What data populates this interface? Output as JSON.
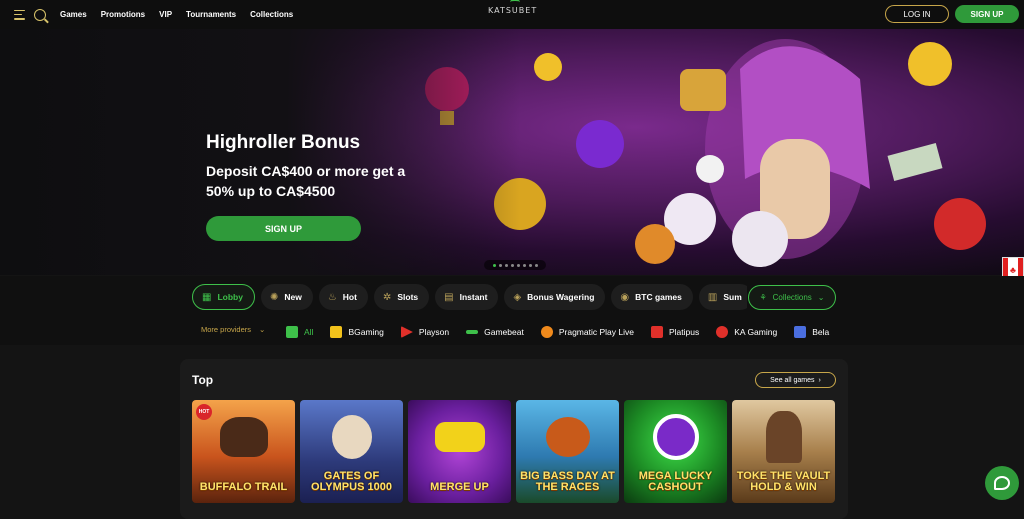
{
  "header": {
    "nav": [
      "Games",
      "Promotions",
      "VIP",
      "Tournaments",
      "Collections"
    ],
    "logo_text": "KATSUBET",
    "login_label": "LOG IN",
    "signup_label": "SIGN UP"
  },
  "hero": {
    "title": "Highroller Bonus",
    "subtitle": "Deposit CA$400 or more get a 50% up to CA$4500",
    "cta_label": "SIGN UP",
    "slides_total": 8,
    "active_slide": 1
  },
  "categories": [
    {
      "label": "Lobby",
      "icon": "lobby-icon",
      "active": true
    },
    {
      "label": "New",
      "icon": "new-icon"
    },
    {
      "label": "Hot",
      "icon": "flame-icon"
    },
    {
      "label": "Slots",
      "icon": "slots-icon"
    },
    {
      "label": "Instant",
      "icon": "instant-icon"
    },
    {
      "label": "Bonus Wagering",
      "icon": "bonus-icon"
    },
    {
      "label": "BTC games",
      "icon": "btc-icon"
    },
    {
      "label": "Sum",
      "icon": "summer-icon"
    }
  ],
  "collections_label": "Collections",
  "providers": {
    "more_label": "More providers",
    "items": [
      {
        "label": "All",
        "color": "#3ec04a"
      },
      {
        "label": "BGaming",
        "color": "#f2c21b"
      },
      {
        "label": "Playson",
        "color": "#e0302a"
      },
      {
        "label": "Gamebeat",
        "color": "#3ec04a"
      },
      {
        "label": "Pragmatic Play Live",
        "color": "#f08a1c"
      },
      {
        "label": "Platipus",
        "color": "#e0302a"
      },
      {
        "label": "KA Gaming",
        "color": "#e0302a"
      },
      {
        "label": "Bela",
        "color": "#4a6ee0"
      }
    ]
  },
  "top_section": {
    "title": "Top",
    "see_all_label": "See all games",
    "games": [
      {
        "title": "BUFFALO TRAIL",
        "hot": "HOT"
      },
      {
        "title": "GATES OF OLYMPUS 1000"
      },
      {
        "title": "MERGE UP"
      },
      {
        "title": "BIG BASS DAY AT THE RACES"
      },
      {
        "title": "MEGA LUCKY CASHOUT"
      },
      {
        "title": "TOKE THE VAULT HOLD & WIN"
      }
    ]
  },
  "colors": {
    "accent_green": "#2f9a3a",
    "accent_gold": "#c7a64a"
  }
}
